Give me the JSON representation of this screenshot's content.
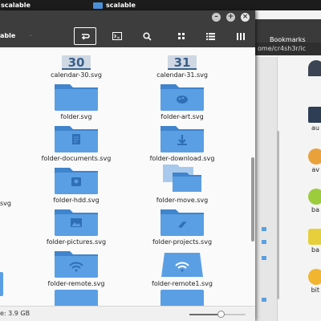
{
  "panel": {
    "tasks": [
      {
        "label": "scalable"
      },
      {
        "label": "scalable"
      }
    ]
  },
  "main_window": {
    "location_label": "able",
    "location_dot": "·",
    "toolbar_icons": [
      "path-toggle-icon",
      "terminal-icon",
      "search-icon",
      "grid-view-icon",
      "list-view-icon",
      "compact-view-icon"
    ],
    "files": [
      {
        "name": "calendar-30.svg",
        "icon": "calendar-icon",
        "badge": "30"
      },
      {
        "name": "calendar-31.svg",
        "icon": "calendar-icon",
        "badge": "31"
      },
      {
        "name": "folder.svg",
        "icon": "folder-icon"
      },
      {
        "name": "folder-art.svg",
        "icon": "folder-art-icon"
      },
      {
        "name": "folder-documents.svg",
        "icon": "folder-documents-icon"
      },
      {
        "name": "folder-download.svg",
        "icon": "folder-download-icon"
      },
      {
        "name": "folder-hdd.svg",
        "icon": "folder-hdd-icon"
      },
      {
        "name": "folder-move.svg",
        "icon": "folder-move-icon"
      },
      {
        "name": "folder-pictures.svg",
        "icon": "folder-pictures-icon"
      },
      {
        "name": "folder-projects.svg",
        "icon": "folder-projects-icon"
      },
      {
        "name": "folder-remote.svg",
        "icon": "folder-remote-icon"
      },
      {
        "name": "folder-remote1.svg",
        "icon": "folder-remote1-icon"
      }
    ],
    "left_cut_label": "svg",
    "status": {
      "free_space": "e: 3.9 GB"
    },
    "zoom_level": 0.55,
    "colors": {
      "folder": "#5a9fe3",
      "folder_dark": "#3f84cc",
      "folder_glyph": "#2f6fb5"
    }
  },
  "background_window": {
    "bookmarks_label": "Bookmarks",
    "path_text": "ome/cr4sh3r/ic",
    "items": [
      {
        "label": "au",
        "color": "#2d3e55"
      },
      {
        "label": "av",
        "color": "#e9a23b"
      },
      {
        "label": "ba",
        "color": "#9ccc3c"
      },
      {
        "label": "ba",
        "color": "#e6cf3b"
      },
      {
        "label": "bit",
        "color": "#f2b530"
      }
    ]
  }
}
